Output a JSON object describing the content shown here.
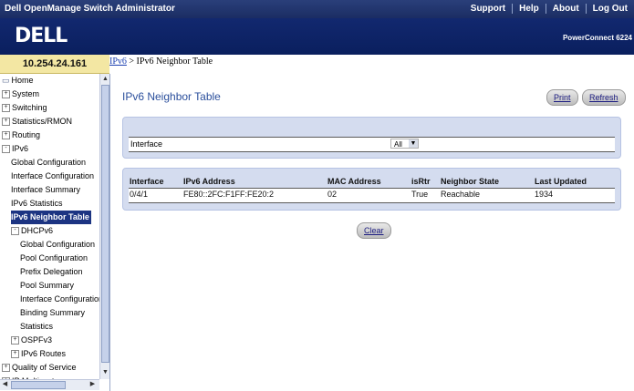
{
  "header": {
    "app_title": "Dell OpenManage Switch Administrator",
    "links": [
      "Support",
      "Help",
      "About",
      "Log Out"
    ],
    "logo": "DELL",
    "product": "PowerConnect 6224"
  },
  "device_ip": "10.254.24.161",
  "breadcrumb": {
    "parent": "IPv6",
    "separator": " > ",
    "current": "IPv6 Neighbor Table"
  },
  "nav": [
    {
      "label": "Home",
      "icon": "folder-icon",
      "indent": 0
    },
    {
      "label": "System",
      "exp": "+",
      "indent": 0
    },
    {
      "label": "Switching",
      "exp": "+",
      "indent": 0
    },
    {
      "label": "Statistics/RMON",
      "exp": "+",
      "indent": 0
    },
    {
      "label": "Routing",
      "exp": "+",
      "indent": 0
    },
    {
      "label": "IPv6",
      "exp": "-",
      "indent": 0
    },
    {
      "label": "Global Configuration",
      "indent": 1
    },
    {
      "label": "Interface Configuration",
      "indent": 1
    },
    {
      "label": "Interface Summary",
      "indent": 1
    },
    {
      "label": "IPv6 Statistics",
      "indent": 1
    },
    {
      "label": "IPv6 Neighbor Table",
      "indent": 1,
      "selected": true
    },
    {
      "label": "DHCPv6",
      "exp": "-",
      "indent": 1
    },
    {
      "label": "Global Configuration",
      "indent": 2
    },
    {
      "label": "Pool Configuration",
      "indent": 2
    },
    {
      "label": "Prefix Delegation",
      "indent": 2
    },
    {
      "label": "Pool Summary",
      "indent": 2
    },
    {
      "label": "Interface Configuration",
      "indent": 2
    },
    {
      "label": "Binding Summary",
      "indent": 2
    },
    {
      "label": "Statistics",
      "indent": 2
    },
    {
      "label": "OSPFv3",
      "exp": "+",
      "indent": 1
    },
    {
      "label": "IPv6 Routes",
      "exp": "+",
      "indent": 1
    },
    {
      "label": "Quality of Service",
      "exp": "+",
      "indent": 0
    },
    {
      "label": "IP Multicast",
      "exp": "+",
      "indent": 0
    }
  ],
  "main": {
    "title": "IPv6 Neighbor Table",
    "print_label": "Print",
    "refresh_label": "Refresh",
    "filter_label": "Interface",
    "filter_value": "All",
    "clear_label": "Clear"
  },
  "table": {
    "headers": [
      "Interface",
      "IPv6 Address",
      "MAC Address",
      "isRtr",
      "Neighbor State",
      "Last Updated"
    ],
    "rows": [
      [
        "0/4/1",
        "FE80::2FC:F1FF:FE20:2",
        "02",
        "True",
        "Reachable",
        "1934"
      ]
    ]
  }
}
